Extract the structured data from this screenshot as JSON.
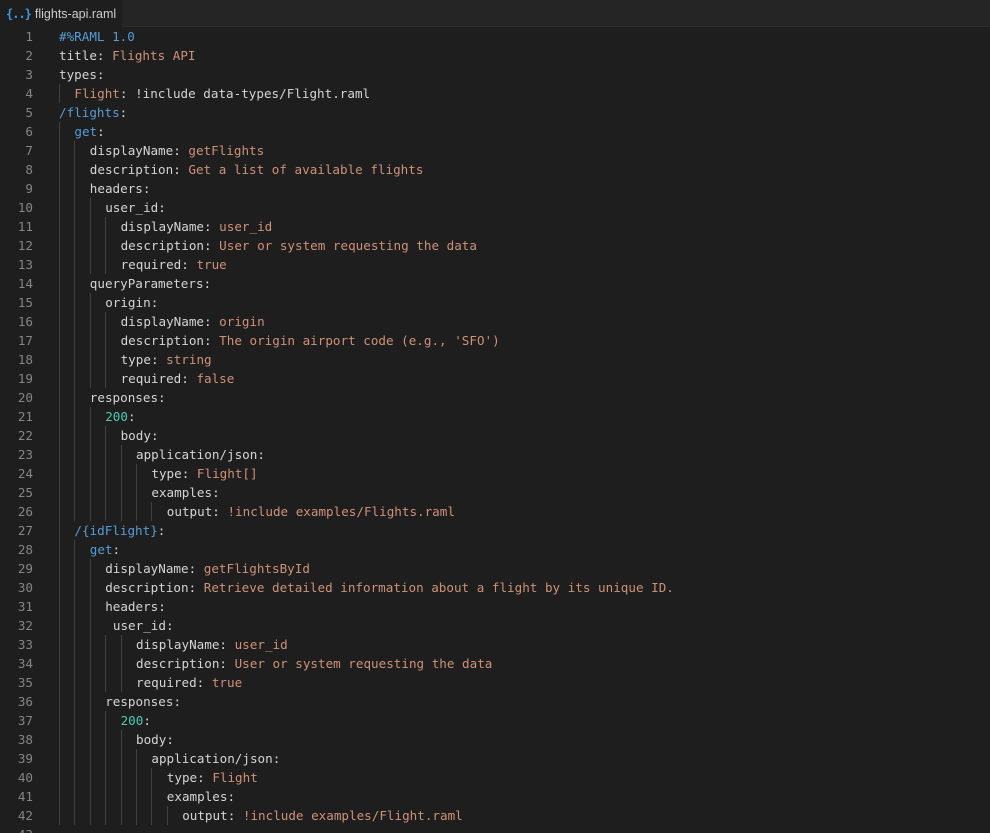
{
  "tab": {
    "icon": "{..}",
    "filename": "flights-api.raml"
  },
  "lines": [
    {
      "n": "1",
      "indent": 0,
      "parts": [
        {
          "t": "#%RAML 1.0",
          "c": "c"
        }
      ]
    },
    {
      "n": "2",
      "indent": 0,
      "parts": [
        {
          "t": "title",
          "c": "k"
        },
        {
          "t": ": ",
          "c": "k"
        },
        {
          "t": "Flights API",
          "c": "v"
        }
      ]
    },
    {
      "n": "3",
      "indent": 0,
      "parts": [
        {
          "t": "types",
          "c": "k"
        },
        {
          "t": ":",
          "c": "k"
        }
      ]
    },
    {
      "n": "4",
      "indent": 1,
      "parts": [
        {
          "t": "Flight",
          "c": "fk"
        },
        {
          "t": ": ",
          "c": "k"
        },
        {
          "t": "!include data-types/Flight.raml",
          "c": "k"
        }
      ]
    },
    {
      "n": "5",
      "indent": 0,
      "parts": [
        {
          "t": "/flights",
          "c": "rk"
        },
        {
          "t": ":",
          "c": "k"
        }
      ]
    },
    {
      "n": "6",
      "indent": 1,
      "parts": [
        {
          "t": "get",
          "c": "rk"
        },
        {
          "t": ":",
          "c": "k"
        }
      ]
    },
    {
      "n": "7",
      "indent": 2,
      "parts": [
        {
          "t": "displayName",
          "c": "k"
        },
        {
          "t": ": ",
          "c": "k"
        },
        {
          "t": "getFlights",
          "c": "v"
        }
      ]
    },
    {
      "n": "8",
      "indent": 2,
      "parts": [
        {
          "t": "description",
          "c": "k"
        },
        {
          "t": ": ",
          "c": "k"
        },
        {
          "t": "Get a list of available flights",
          "c": "v"
        }
      ]
    },
    {
      "n": "9",
      "indent": 2,
      "parts": [
        {
          "t": "headers",
          "c": "k"
        },
        {
          "t": ":",
          "c": "k"
        }
      ]
    },
    {
      "n": "10",
      "indent": 3,
      "parts": [
        {
          "t": "user_id",
          "c": "k"
        },
        {
          "t": ":",
          "c": "k"
        }
      ]
    },
    {
      "n": "11",
      "indent": 4,
      "parts": [
        {
          "t": "displayName",
          "c": "k"
        },
        {
          "t": ": ",
          "c": "k"
        },
        {
          "t": "user_id",
          "c": "v"
        }
      ]
    },
    {
      "n": "12",
      "indent": 4,
      "parts": [
        {
          "t": "description",
          "c": "k"
        },
        {
          "t": ": ",
          "c": "k"
        },
        {
          "t": "User or system requesting the data",
          "c": "v"
        }
      ]
    },
    {
      "n": "13",
      "indent": 4,
      "parts": [
        {
          "t": "required",
          "c": "k"
        },
        {
          "t": ": ",
          "c": "k"
        },
        {
          "t": "true",
          "c": "v"
        }
      ]
    },
    {
      "n": "14",
      "indent": 2,
      "parts": [
        {
          "t": "queryParameters",
          "c": "k"
        },
        {
          "t": ":",
          "c": "k"
        }
      ]
    },
    {
      "n": "15",
      "indent": 3,
      "parts": [
        {
          "t": "origin",
          "c": "k"
        },
        {
          "t": ":",
          "c": "k"
        }
      ]
    },
    {
      "n": "16",
      "indent": 4,
      "parts": [
        {
          "t": "displayName",
          "c": "k"
        },
        {
          "t": ": ",
          "c": "k"
        },
        {
          "t": "origin",
          "c": "v"
        }
      ]
    },
    {
      "n": "17",
      "indent": 4,
      "parts": [
        {
          "t": "description",
          "c": "k"
        },
        {
          "t": ": ",
          "c": "k"
        },
        {
          "t": "The origin airport code (e.g., 'SFO')",
          "c": "v"
        }
      ]
    },
    {
      "n": "18",
      "indent": 4,
      "parts": [
        {
          "t": "type",
          "c": "k"
        },
        {
          "t": ": ",
          "c": "k"
        },
        {
          "t": "string",
          "c": "v"
        }
      ]
    },
    {
      "n": "19",
      "indent": 4,
      "parts": [
        {
          "t": "required",
          "c": "k"
        },
        {
          "t": ": ",
          "c": "k"
        },
        {
          "t": "false",
          "c": "v"
        }
      ]
    },
    {
      "n": "20",
      "indent": 2,
      "parts": [
        {
          "t": "responses",
          "c": "k"
        },
        {
          "t": ":",
          "c": "k"
        }
      ]
    },
    {
      "n": "21",
      "indent": 3,
      "parts": [
        {
          "t": "200",
          "c": "n"
        },
        {
          "t": ":",
          "c": "k"
        }
      ]
    },
    {
      "n": "22",
      "indent": 4,
      "parts": [
        {
          "t": "body",
          "c": "k"
        },
        {
          "t": ":",
          "c": "k"
        }
      ]
    },
    {
      "n": "23",
      "indent": 5,
      "parts": [
        {
          "t": "application/json",
          "c": "k"
        },
        {
          "t": ":",
          "c": "k"
        }
      ]
    },
    {
      "n": "24",
      "indent": 6,
      "parts": [
        {
          "t": "type",
          "c": "k"
        },
        {
          "t": ": ",
          "c": "k"
        },
        {
          "t": "Flight[]",
          "c": "v"
        }
      ]
    },
    {
      "n": "25",
      "indent": 6,
      "parts": [
        {
          "t": "examples",
          "c": "k"
        },
        {
          "t": ":",
          "c": "k"
        }
      ]
    },
    {
      "n": "26",
      "indent": 7,
      "parts": [
        {
          "t": "output",
          "c": "k"
        },
        {
          "t": ": ",
          "c": "k"
        },
        {
          "t": "!include examples/Flights.raml",
          "c": "v"
        }
      ]
    },
    {
      "n": "27",
      "indent": 1,
      "parts": [
        {
          "t": "/{idFlight}",
          "c": "rk"
        },
        {
          "t": ":",
          "c": "k"
        }
      ]
    },
    {
      "n": "28",
      "indent": 2,
      "parts": [
        {
          "t": "get",
          "c": "rk"
        },
        {
          "t": ":",
          "c": "k"
        }
      ]
    },
    {
      "n": "29",
      "indent": 3,
      "parts": [
        {
          "t": "displayName",
          "c": "k"
        },
        {
          "t": ": ",
          "c": "k"
        },
        {
          "t": "getFlightsById",
          "c": "v"
        }
      ]
    },
    {
      "n": "30",
      "indent": 3,
      "parts": [
        {
          "t": "description",
          "c": "k"
        },
        {
          "t": ": ",
          "c": "k"
        },
        {
          "t": "Retrieve detailed information about a flight by its unique ID.",
          "c": "v"
        }
      ]
    },
    {
      "n": "31",
      "indent": 3,
      "parts": [
        {
          "t": "headers",
          "c": "k"
        },
        {
          "t": ":",
          "c": "k"
        }
      ]
    },
    {
      "n": "32",
      "indent": 3.5,
      "parts": [
        {
          "t": "user_id",
          "c": "k"
        },
        {
          "t": ":",
          "c": "k"
        }
      ]
    },
    {
      "n": "33",
      "indent": 5,
      "parts": [
        {
          "t": "displayName",
          "c": "k"
        },
        {
          "t": ": ",
          "c": "k"
        },
        {
          "t": "user_id",
          "c": "v"
        }
      ]
    },
    {
      "n": "34",
      "indent": 5,
      "parts": [
        {
          "t": "description",
          "c": "k"
        },
        {
          "t": ": ",
          "c": "k"
        },
        {
          "t": "User or system requesting the data",
          "c": "v"
        }
      ]
    },
    {
      "n": "35",
      "indent": 5,
      "parts": [
        {
          "t": "required",
          "c": "k"
        },
        {
          "t": ": ",
          "c": "k"
        },
        {
          "t": "true",
          "c": "v"
        }
      ]
    },
    {
      "n": "36",
      "indent": 3,
      "parts": [
        {
          "t": "responses",
          "c": "k"
        },
        {
          "t": ":",
          "c": "k"
        }
      ]
    },
    {
      "n": "37",
      "indent": 4,
      "parts": [
        {
          "t": "200",
          "c": "n"
        },
        {
          "t": ":",
          "c": "k"
        }
      ]
    },
    {
      "n": "38",
      "indent": 5,
      "parts": [
        {
          "t": "body",
          "c": "k"
        },
        {
          "t": ":",
          "c": "k"
        }
      ]
    },
    {
      "n": "39",
      "indent": 6,
      "parts": [
        {
          "t": "application/json",
          "c": "k"
        },
        {
          "t": ":",
          "c": "k"
        }
      ]
    },
    {
      "n": "40",
      "indent": 7,
      "parts": [
        {
          "t": "type",
          "c": "k"
        },
        {
          "t": ": ",
          "c": "k"
        },
        {
          "t": "Flight",
          "c": "v"
        }
      ]
    },
    {
      "n": "41",
      "indent": 7,
      "parts": [
        {
          "t": "examples",
          "c": "k"
        },
        {
          "t": ":",
          "c": "k"
        }
      ]
    },
    {
      "n": "42",
      "indent": 8,
      "parts": [
        {
          "t": "output",
          "c": "k"
        },
        {
          "t": ": ",
          "c": "k"
        },
        {
          "t": "!include examples/Flight.raml",
          "c": "v"
        }
      ]
    },
    {
      "n": "43",
      "indent": 0,
      "parts": []
    }
  ]
}
